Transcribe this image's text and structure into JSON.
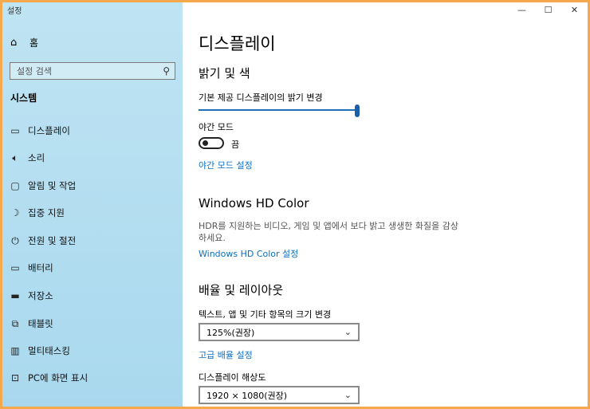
{
  "window": {
    "title": "설정"
  },
  "sidebar": {
    "home_label": "홈",
    "search_placeholder": "설정 검색",
    "section_label": "시스템",
    "items": [
      {
        "icon": "monitor-icon",
        "label": "디스플레이"
      },
      {
        "icon": "speaker-icon",
        "label": "소리"
      },
      {
        "icon": "notification-icon",
        "label": "알림 및 작업"
      },
      {
        "icon": "moon-icon",
        "label": "집중 지원"
      },
      {
        "icon": "power-icon",
        "label": "전원 및 절전"
      },
      {
        "icon": "battery-icon",
        "label": "배터리"
      },
      {
        "icon": "storage-icon",
        "label": "저장소"
      },
      {
        "icon": "tablet-icon",
        "label": "태블릿"
      },
      {
        "icon": "multitasking-icon",
        "label": "멀티태스킹"
      },
      {
        "icon": "projection-icon",
        "label": "PC에 화면 표시"
      }
    ]
  },
  "main": {
    "title": "디스플레이",
    "brightness": {
      "heading": "밝기 및 색",
      "slider_label": "기본 제공 디스플레이의 밝기 변경",
      "level": 1.0,
      "night_label": "야간 모드",
      "toggle_state": "끔",
      "night_link": "야간 모드 설정"
    },
    "hdr": {
      "heading": "Windows HD Color",
      "description": "HDR를 지원하는 비디오, 게임 및 앱에서 보다 밝고 생생한 화질을 감상하세요.",
      "link": "Windows HD Color 설정"
    },
    "scale": {
      "heading": "배율 및 레이아웃",
      "label": "텍스트, 앱 및 기타 항목의 크기 변경",
      "value": "125%(권장)",
      "link": "고급 배율 설정",
      "resolution_label": "디스플레이 해상도",
      "resolution_value": "1920 × 1080(권장)"
    }
  },
  "colors": {
    "accent": "#0b6fc2",
    "sidebar": "#bfe4f3",
    "frame": "#f5a94c"
  }
}
